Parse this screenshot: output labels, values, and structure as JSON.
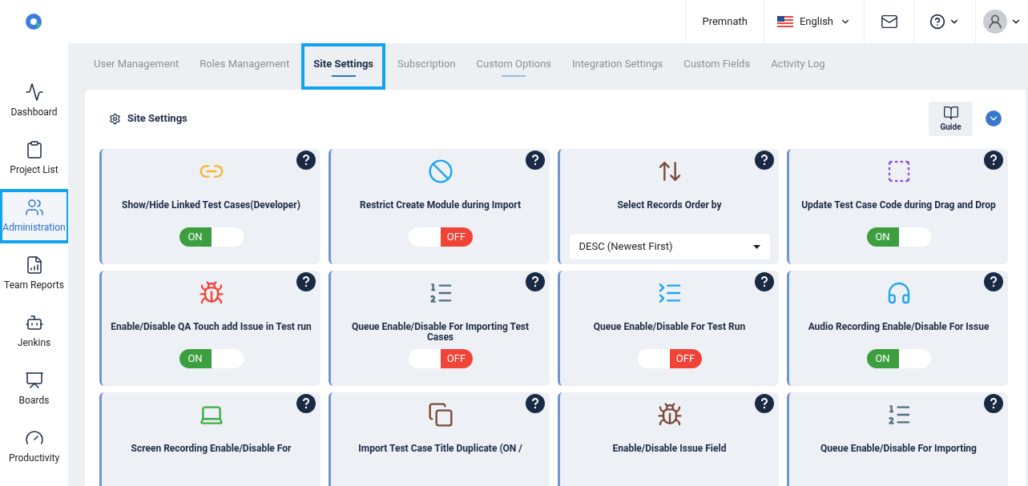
{
  "header": {
    "user_name": "Premnath",
    "language": "English"
  },
  "sidebar": {
    "items": [
      {
        "label": "Dashboard",
        "selected": false
      },
      {
        "label": "Project List",
        "selected": false
      },
      {
        "label": "Administration",
        "selected": true
      },
      {
        "label": "Team Reports",
        "selected": false
      },
      {
        "label": "Jenkins",
        "selected": false
      },
      {
        "label": "Boards",
        "selected": false
      },
      {
        "label": "Productivity",
        "selected": false
      }
    ]
  },
  "tabs": [
    {
      "label": "User Management",
      "selected": false,
      "hovered": false
    },
    {
      "label": "Roles Management",
      "selected": false,
      "hovered": false
    },
    {
      "label": "Site Settings",
      "selected": true,
      "hovered": false
    },
    {
      "label": "Subscription",
      "selected": false,
      "hovered": false
    },
    {
      "label": "Custom Options",
      "selected": false,
      "hovered": true
    },
    {
      "label": "Integration Settings",
      "selected": false,
      "hovered": false
    },
    {
      "label": "Custom Fields",
      "selected": false,
      "hovered": false
    },
    {
      "label": "Activity Log",
      "selected": false,
      "hovered": false
    }
  ],
  "panel": {
    "title": "Site Settings",
    "guide_label": "Guide"
  },
  "settings": [
    {
      "kind": "toggle",
      "title": "Show/Hide Linked Test Cases(Developer)",
      "on": true,
      "label": "ON"
    },
    {
      "kind": "toggle",
      "title": "Restrict Create Module during Import",
      "on": false,
      "label": "OFF"
    },
    {
      "kind": "select",
      "title": "Select Records Order by",
      "value": "DESC (Newest First)"
    },
    {
      "kind": "toggle",
      "title": "Update Test Case Code during Drag and Drop",
      "on": true,
      "label": "ON"
    },
    {
      "kind": "toggle",
      "title": "Enable/Disable QA Touch add Issue in Test run",
      "on": true,
      "label": "ON"
    },
    {
      "kind": "toggle",
      "title": "Queue Enable/Disable For Importing Test Cases",
      "on": false,
      "label": "OFF"
    },
    {
      "kind": "toggle",
      "title": "Queue Enable/Disable For Test Run",
      "on": false,
      "label": "OFF"
    },
    {
      "kind": "toggle",
      "title": "Audio Recording Enable/Disable For Issue",
      "on": true,
      "label": "ON"
    },
    {
      "kind": "cut",
      "title": "Screen Recording Enable/Disable For"
    },
    {
      "kind": "cut",
      "title": "Import Test Case Title Duplicate (ON /"
    },
    {
      "kind": "cut",
      "title": "Enable/Disable Issue Field"
    },
    {
      "kind": "cut",
      "title": "Queue Enable/Disable For Importing"
    }
  ]
}
